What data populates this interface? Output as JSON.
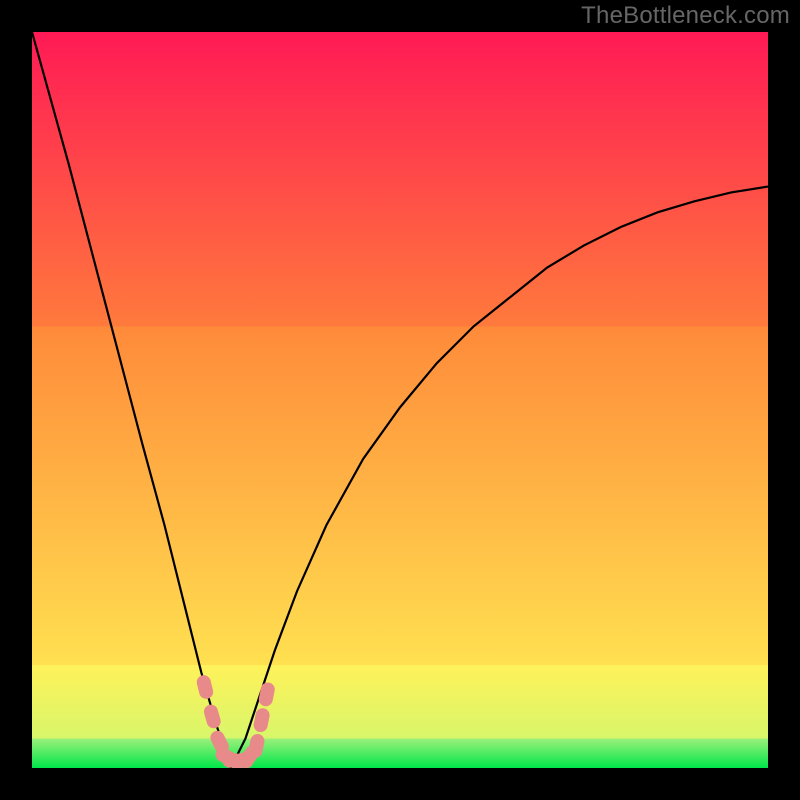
{
  "watermark": "TheBottleneck.com",
  "chart_data": {
    "type": "line",
    "title": "",
    "xlabel": "",
    "ylabel": "",
    "xlim": [
      0,
      100
    ],
    "ylim": [
      0,
      100
    ],
    "x_optimum": 27,
    "curve": {
      "x": [
        0,
        5,
        10,
        15,
        18,
        21,
        23,
        25,
        27,
        29,
        31,
        33,
        36,
        40,
        45,
        50,
        55,
        60,
        65,
        70,
        75,
        80,
        85,
        90,
        95,
        100
      ],
      "y": [
        100,
        82,
        63,
        44,
        33,
        21,
        13,
        6,
        0,
        4,
        10,
        16,
        24,
        33,
        42,
        49,
        55,
        60,
        64,
        68,
        71,
        73.5,
        75.5,
        77,
        78.2,
        79
      ]
    },
    "markers": {
      "x": [
        23.5,
        24.5,
        25.5,
        26.5,
        27.5,
        28.5,
        29.5,
        30.5,
        31.2,
        31.9
      ],
      "y": [
        11,
        7,
        3.5,
        1.5,
        1,
        1,
        1.5,
        3,
        6.5,
        10
      ]
    },
    "bands": [
      {
        "name": "green",
        "y0": 0,
        "y1": 4,
        "color0": "#00e64a",
        "color1": "#9cf07a"
      },
      {
        "name": "yellow",
        "y0": 4,
        "y1": 14,
        "color0": "#d8f66a",
        "color1": "#fff25a"
      },
      {
        "name": "orange",
        "y0": 14,
        "y1": 60,
        "color0": "#ffe050",
        "color1": "#ff8a3a"
      },
      {
        "name": "red",
        "y0": 60,
        "y1": 100,
        "color0": "#ff7a3c",
        "color1": "#ff1a55"
      }
    ],
    "marker_color": "#e98a8a",
    "curve_color": "#000000"
  }
}
